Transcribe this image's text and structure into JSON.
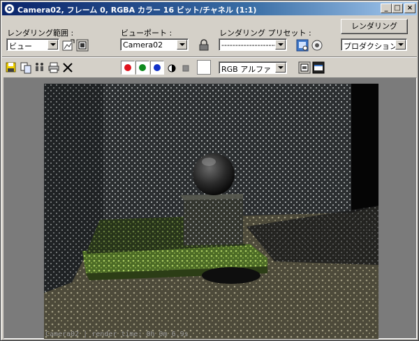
{
  "window": {
    "title": "Camera02, フレーム 0, RGBA カラー 16 ビット/チャネル (1:1)",
    "minimize_label": "_",
    "maximize_label": "□",
    "close_label": "×"
  },
  "controls": {
    "render_area_label": "レンダリング範囲 :",
    "render_area_value": "ビュー",
    "viewport_label": "ビューポート :",
    "viewport_value": "Camera02",
    "preset_label": "レンダリング プリセット :",
    "preset_value": "---------------------",
    "render_button": "レンダリング",
    "mode_value": "プロダクション",
    "channel_value": "RGB アルファ"
  },
  "channels": [
    {
      "name": "red",
      "color": "#e0141e"
    },
    {
      "name": "green",
      "color": "#0f8a1e"
    },
    {
      "name": "blue",
      "color": "#1232c8"
    }
  ],
  "viewer": {
    "caption": "Camera02 | render time: 0h 0m 6.9s"
  }
}
